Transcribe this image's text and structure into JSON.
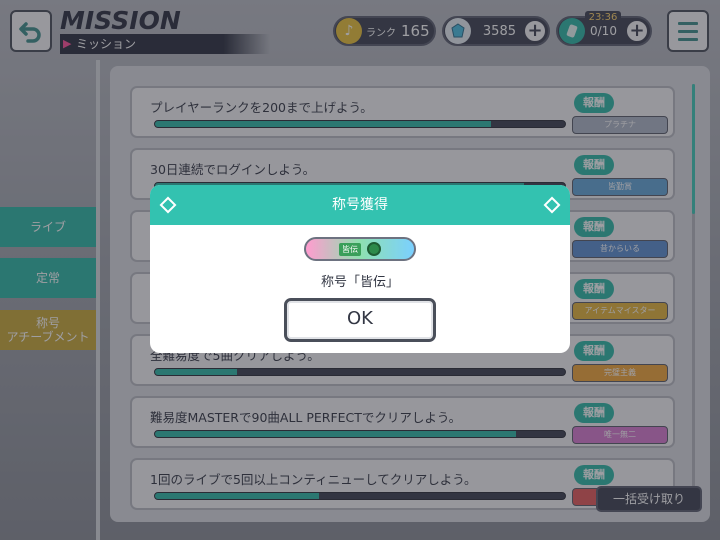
{
  "header": {
    "title": "MISSION",
    "subtitle": "ミッション",
    "rank_label": "ランク",
    "rank_value": "165",
    "crystals": "3585",
    "energy_timer": "23:36",
    "energy": "0/10",
    "plus": "+"
  },
  "sidebar": {
    "items": [
      {
        "label": "ライブ",
        "color": "#2fb9a7"
      },
      {
        "label": "定常",
        "color": "#2fb9a7"
      },
      {
        "label": "称号\nアチーブメント",
        "color": "#c9a93a"
      }
    ]
  },
  "missions": [
    {
      "text": "プレイヤーランクを200まで上げよう。",
      "progress": 0.82,
      "reward_label": "報酬",
      "reward": "プラチナ",
      "reward_color": "#aeb7c6"
    },
    {
      "text": "30日連続でログインしよう。",
      "progress": 0.9,
      "reward_label": "報酬",
      "reward": "皆勤賞",
      "reward_color": "#63a7d8"
    },
    {
      "text": "",
      "progress": 0.5,
      "reward_label": "報酬",
      "reward": "昔からいる",
      "reward_color": "#5c8fd0"
    },
    {
      "text": "",
      "progress": 0.5,
      "reward_label": "報酬",
      "reward": "アイテムマイスター",
      "reward_color": "#e3b43b"
    },
    {
      "text": "全難易度で5曲クリアしよう。",
      "progress": 0.2,
      "reward_label": "報酬",
      "reward": "完璧主義",
      "reward_color": "#f1a63a"
    },
    {
      "text": "難易度MASTERで90曲ALL PERFECTでクリアしよう。",
      "progress": 0.88,
      "reward_label": "報酬",
      "reward": "唯一無二",
      "reward_color": "#d77ad0"
    },
    {
      "text": "1回のライブで5回以上コンティニューしてクリアしよう。",
      "progress": 0.4,
      "reward_label": "報酬",
      "reward": "",
      "reward_color": "#e35a5a"
    }
  ],
  "bulk_button": "一括受け取り",
  "modal": {
    "header": "称号獲得",
    "plate_tag": "皆伝",
    "message": "称号「皆伝」",
    "ok": "OK"
  },
  "colors": {
    "accent": "#33c2b0",
    "dark": "#3e4352"
  },
  "icons": [
    "back-arrow-icon",
    "menu-icon",
    "music-note-icon",
    "crystal-icon",
    "energy-icon",
    "diamond-icon"
  ]
}
